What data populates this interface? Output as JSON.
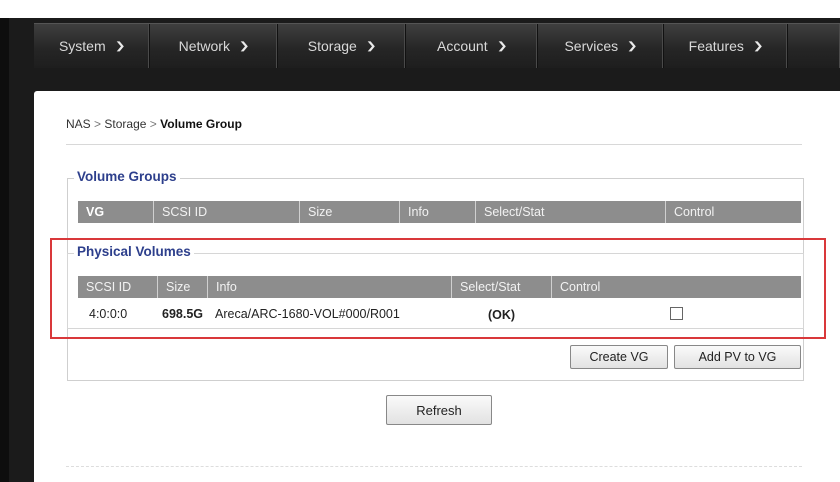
{
  "nav": {
    "items": [
      {
        "label": "System"
      },
      {
        "label": "Network"
      },
      {
        "label": "Storage"
      },
      {
        "label": "Account"
      },
      {
        "label": "Services"
      },
      {
        "label": "Features"
      }
    ]
  },
  "breadcrumb": {
    "part1": "NAS",
    "sep": ">",
    "part2": "Storage",
    "current": "Volume Group"
  },
  "volume_groups": {
    "legend": "Volume Groups",
    "headers": [
      "VG",
      "SCSI ID",
      "Size",
      "Info",
      "Select/Stat",
      "Control"
    ]
  },
  "physical_volumes": {
    "legend": "Physical Volumes",
    "headers": [
      "SCSI ID",
      "Size",
      "Info",
      "Select/Stat",
      "Control"
    ],
    "rows": [
      {
        "scsi_id": "4:0:0:0",
        "size": "698.5G",
        "info": "Areca/ARC-1680-VOL#000/R001",
        "status": "(OK)",
        "selected": false
      }
    ]
  },
  "buttons": {
    "create_vg": "Create VG",
    "add_pv": "Add PV to VG",
    "refresh": "Refresh"
  },
  "colors": {
    "highlight": "#d9383a",
    "legend_text": "#2d3f8c",
    "table_header": "#8d8d8d",
    "nav_bg": "#2a2a2a"
  }
}
